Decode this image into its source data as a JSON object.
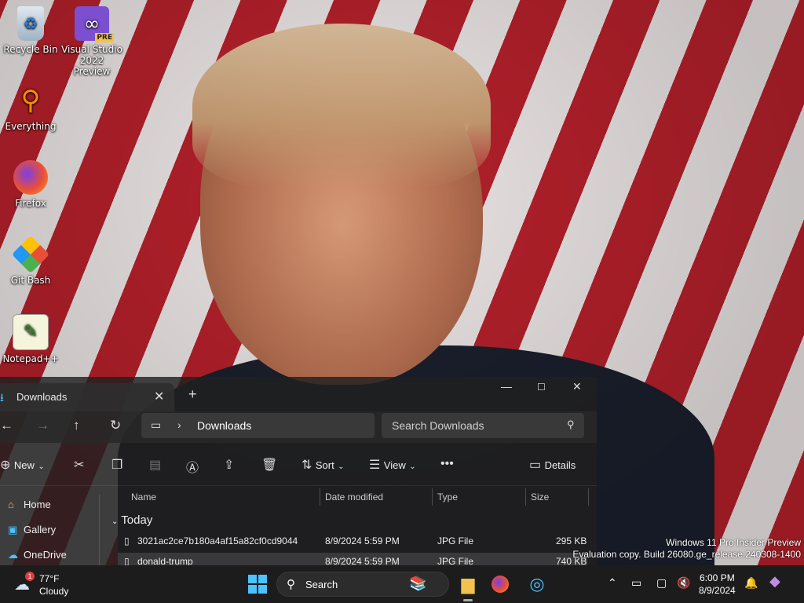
{
  "desktop": {
    "icons": [
      {
        "label": "Recycle Bin",
        "icon": "recycle-bin-icon"
      },
      {
        "label": "Visual Studio 2022 Preview",
        "badge": "PRE",
        "icon": "visual-studio-icon"
      },
      {
        "label": "Everything",
        "icon": "everything-search-icon"
      },
      {
        "label": "Firefox",
        "icon": "firefox-icon"
      },
      {
        "label": "Git Bash",
        "icon": "git-bash-icon"
      },
      {
        "label": "Notepad++",
        "icon": "notepadpp-icon"
      }
    ]
  },
  "explorer": {
    "tab_title": "Downloads",
    "breadcrumb": "Downloads",
    "search_placeholder": "Search Downloads",
    "toolbar": {
      "new_label": "New",
      "sort_label": "Sort",
      "view_label": "View",
      "details_label": "Details"
    },
    "nav": [
      {
        "label": "Home",
        "icon": "home-icon"
      },
      {
        "label": "Gallery",
        "icon": "gallery-icon"
      },
      {
        "label": "OneDrive",
        "icon": "onedrive-icon"
      }
    ],
    "columns": [
      "Name",
      "Date modified",
      "Type",
      "Size"
    ],
    "group": "Today",
    "files": [
      {
        "name": "3021ac2ce7b180a4af15a82cf0cd9044",
        "date": "8/9/2024 5:59 PM",
        "type": "JPG File",
        "size": "295 KB"
      },
      {
        "name": "donald-trump",
        "date": "8/9/2024 5:59 PM",
        "type": "JPG File",
        "size": "740 KB"
      }
    ]
  },
  "watermark": {
    "line1": "Windows 11 Pro Insider Preview",
    "line2": "Evaluation copy. Build 26080.ge_release.240308-1400"
  },
  "taskbar": {
    "weather_temp": "77°F",
    "weather_condition": "Cloudy",
    "weather_badge": "1",
    "search_label": "Search",
    "time": "6:00 PM",
    "date": "8/9/2024"
  },
  "colors": {
    "accent": "#4cc2ff",
    "taskbar": "#1c1c1c",
    "folder": "#f2c14e"
  }
}
